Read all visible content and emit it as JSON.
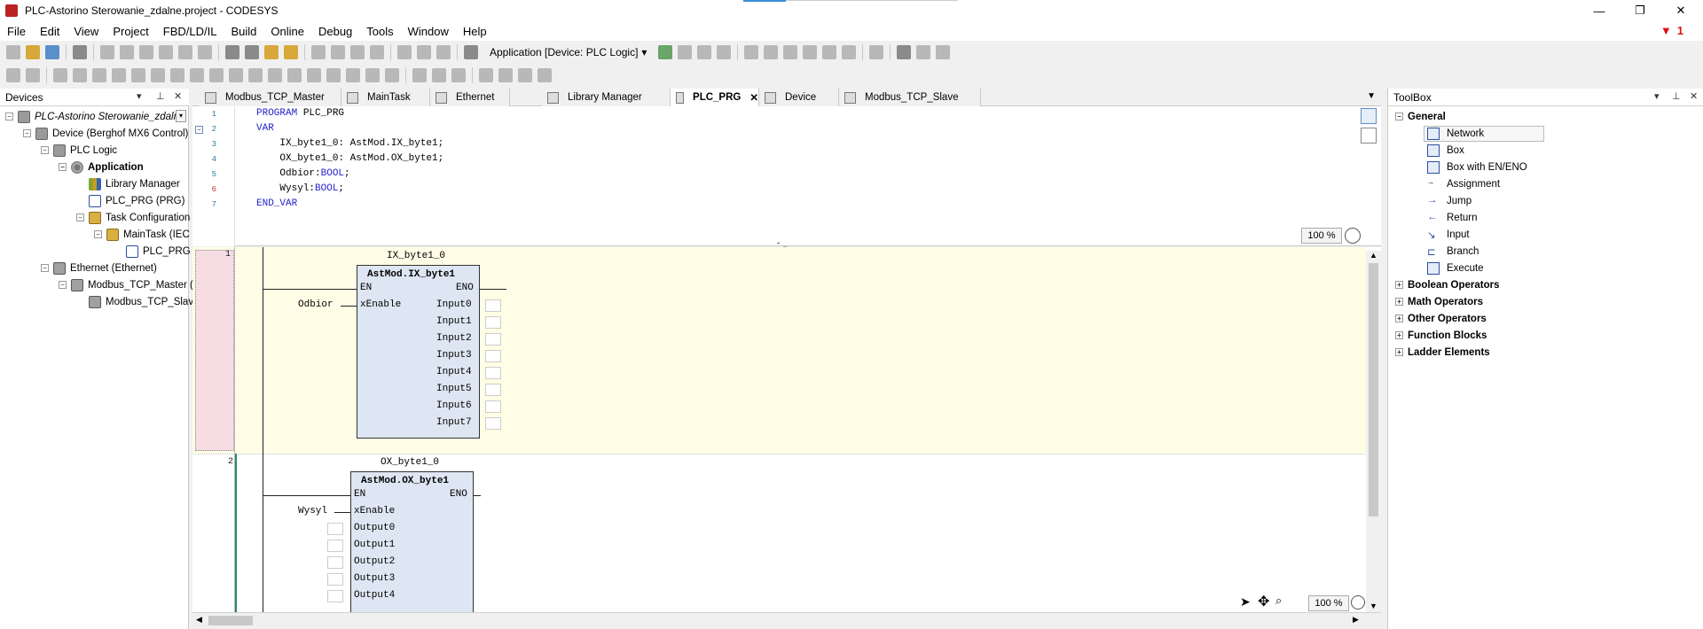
{
  "window": {
    "title": "PLC-Astorino Sterowanie_zdalne.project - CODESYS",
    "controls": {
      "minimize": "—",
      "restore": "❐",
      "close": "✕"
    }
  },
  "menu": {
    "items": [
      "File",
      "Edit",
      "View",
      "Project",
      "FBD/LD/IL",
      "Build",
      "Online",
      "Debug",
      "Tools",
      "Window",
      "Help"
    ],
    "filter_count": "1"
  },
  "toolbar": {
    "application_selector": "Application [Device: PLC Logic]"
  },
  "devices_panel": {
    "title": "Devices",
    "tree": [
      {
        "label": "PLC-Astorino Sterowanie_zdalne",
        "icon": "project-icon",
        "expander": "−",
        "italic": true
      },
      {
        "label": "Device (Berghof MX6 Control)",
        "icon": "device-icon",
        "expander": "−"
      },
      {
        "label": "PLC Logic",
        "icon": "plc-logic-icon",
        "expander": "−"
      },
      {
        "label": "Application",
        "icon": "application-icon",
        "expander": "−",
        "bold": true
      },
      {
        "label": "Library Manager",
        "icon": "library-icon",
        "expander": ""
      },
      {
        "label": "PLC_PRG (PRG)",
        "icon": "program-icon",
        "expander": ""
      },
      {
        "label": "Task Configuration",
        "icon": "task-config-icon",
        "expander": "−"
      },
      {
        "label": "MainTask (IEC",
        "icon": "task-icon",
        "expander": "−"
      },
      {
        "label": "PLC_PRG",
        "icon": "program-call-icon",
        "expander": ""
      },
      {
        "label": "Ethernet (Ethernet)",
        "icon": "ethernet-icon",
        "expander": "−"
      },
      {
        "label": "Modbus_TCP_Master (",
        "icon": "modbus-master-icon",
        "expander": "−"
      },
      {
        "label": "Modbus_TCP_Slave",
        "icon": "modbus-slave-icon",
        "expander": ""
      }
    ]
  },
  "editor": {
    "tabs": [
      {
        "label": "Modbus_TCP_Master",
        "active": false
      },
      {
        "label": "MainTask",
        "active": false
      },
      {
        "label": "Ethernet",
        "active": false
      },
      {
        "label": "Library Manager",
        "active": false
      },
      {
        "label": "PLC_PRG",
        "active": true,
        "close": "✕"
      },
      {
        "label": "Device",
        "active": false
      },
      {
        "label": "Modbus_TCP_Slave",
        "active": false
      }
    ],
    "declaration": {
      "lines": [
        {
          "num": "1",
          "kw": "PROGRAM",
          "text": " PLC_PRG"
        },
        {
          "num": "2",
          "kw": "VAR",
          "text": ""
        },
        {
          "num": "3",
          "kw": "",
          "text": "    IX_byte1_0: AstMod.IX_byte1;"
        },
        {
          "num": "4",
          "kw": "",
          "text": "    OX_byte1_0: AstMod.OX_byte1;"
        },
        {
          "num": "5",
          "kw": "",
          "text": "    Odbior:",
          "type": "BOOL",
          "end": ";"
        },
        {
          "num": "6",
          "kw": "",
          "text": "    Wysyl:",
          "type": "BOOL",
          "end": ";"
        },
        {
          "num": "7",
          "kw": "END_VAR",
          "text": ""
        }
      ],
      "zoom": "100 %"
    },
    "networks": [
      {
        "num": "1",
        "instance": "IX_byte1_0",
        "block_type": "AstMod.IX_byte1",
        "en": "EN",
        "eno": "ENO",
        "input_var": "Odbior",
        "input_pin": "xEnable",
        "outputs": [
          "Input0",
          "Input1",
          "Input2",
          "Input3",
          "Input4",
          "Input5",
          "Input6",
          "Input7"
        ]
      },
      {
        "num": "2",
        "instance": "OX_byte1_0",
        "block_type": "AstMod.OX_byte1",
        "en": "EN",
        "eno": "ENO",
        "input_var": "Wysyl",
        "input_pin": "xEnable",
        "inputs": [
          "Output0",
          "Output1",
          "Output2",
          "Output3",
          "Output4"
        ]
      }
    ],
    "fbd_zoom": "100 %"
  },
  "toolbox": {
    "title": "ToolBox",
    "general_label": "General",
    "general_items": [
      "Network",
      "Box",
      "Box with EN/ENO",
      "Assignment",
      "Jump",
      "Return",
      "Input",
      "Branch",
      "Execute"
    ],
    "categories": [
      "Boolean Operators",
      "Math Operators",
      "Other Operators",
      "Function Blocks",
      "Ladder Elements"
    ]
  },
  "colors": {
    "network1_bg": "#fffde6",
    "block_fill": "#dde6f2",
    "keyword": "#1f1fc8",
    "selection": "#f6dde4"
  }
}
